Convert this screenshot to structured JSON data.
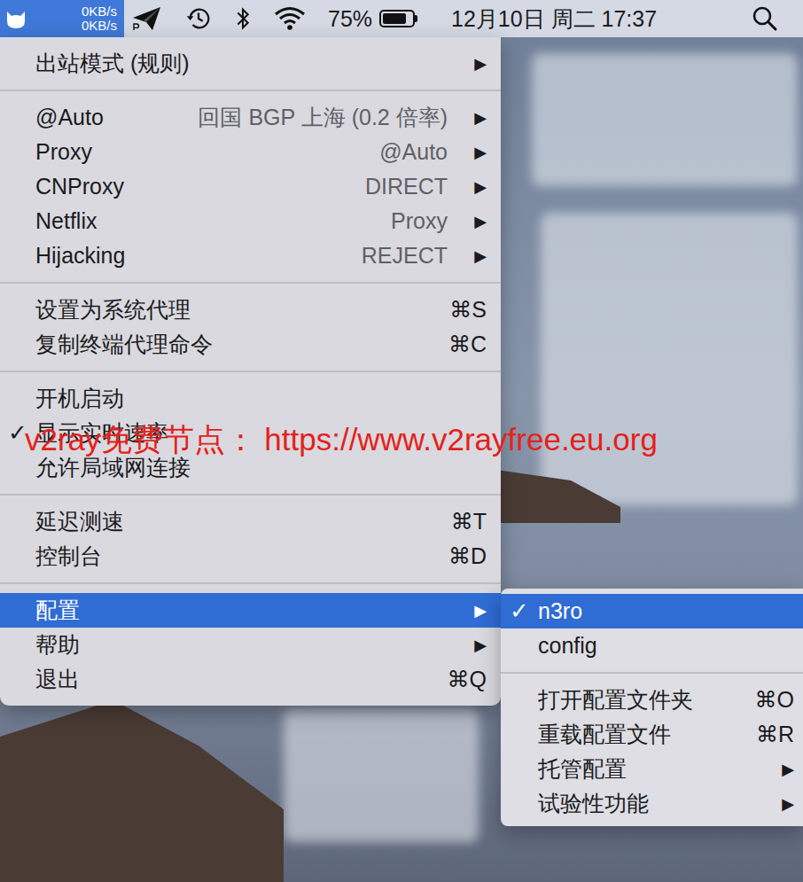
{
  "menu_bar": {
    "app_selected": true,
    "speed_up": "0KB/s",
    "speed_down": "0KB/s",
    "battery": "75%",
    "battery_level": 0.75,
    "clock": "12月10日 周二 17:37"
  },
  "check_mark": "✓",
  "menu": {
    "items": [
      {
        "kind": "submenu",
        "label": "出站模式 (规则)",
        "arrow": "▶",
        "selected": false
      },
      {
        "kind": "separator"
      },
      {
        "kind": "group",
        "label": "@Auto",
        "value": "回国 BGP 上海 (0.2 倍率)",
        "arrow": "▶",
        "selected": false
      },
      {
        "kind": "group",
        "label": "Proxy",
        "value": "@Auto",
        "arrow": "▶",
        "selected": false
      },
      {
        "kind": "group",
        "label": "CNProxy",
        "value": "DIRECT",
        "arrow": "▶",
        "selected": false
      },
      {
        "kind": "group",
        "label": "Netflix",
        "value": "Proxy",
        "arrow": "▶",
        "selected": false
      },
      {
        "kind": "group",
        "label": "Hijacking",
        "value": "REJECT",
        "arrow": "▶",
        "selected": false
      },
      {
        "kind": "separator"
      },
      {
        "kind": "command",
        "label": "设置为系统代理",
        "shortcut": "⌘S",
        "selected": false
      },
      {
        "kind": "command",
        "label": "复制终端代理命令",
        "shortcut": "⌘C",
        "selected": false
      },
      {
        "kind": "separator"
      },
      {
        "kind": "toggle",
        "label": "开机启动",
        "checked": false,
        "selected": false
      },
      {
        "kind": "toggle",
        "label": "显示实时速率",
        "checked": true,
        "selected": false
      },
      {
        "kind": "toggle",
        "label": "允许局域网连接",
        "checked": false,
        "selected": false
      },
      {
        "kind": "separator"
      },
      {
        "kind": "command",
        "label": "延迟测速",
        "shortcut": "⌘T",
        "selected": false
      },
      {
        "kind": "command",
        "label": "控制台",
        "shortcut": "⌘D",
        "selected": false
      },
      {
        "kind": "separator"
      },
      {
        "kind": "submenu",
        "label": "配置",
        "arrow": "▶",
        "selected": true
      },
      {
        "kind": "submenu",
        "label": "帮助",
        "arrow": "▶",
        "selected": false
      },
      {
        "kind": "command",
        "label": "退出",
        "shortcut": "⌘Q",
        "selected": false
      }
    ]
  },
  "submenu": {
    "items": [
      {
        "kind": "profile",
        "label": "n3ro",
        "checked": true,
        "selected": true
      },
      {
        "kind": "profile",
        "label": "config",
        "checked": false,
        "selected": false
      },
      {
        "kind": "separator"
      },
      {
        "kind": "command",
        "label": "打开配置文件夹",
        "shortcut": "⌘O",
        "selected": false
      },
      {
        "kind": "command",
        "label": "重载配置文件",
        "shortcut": "⌘R",
        "selected": false
      },
      {
        "kind": "submenu",
        "label": "托管配置",
        "arrow": "▶",
        "selected": false
      },
      {
        "kind": "submenu",
        "label": "试验性功能",
        "arrow": "▶",
        "selected": false
      }
    ]
  },
  "watermark": "v2ray免费节点： https://www.v2rayfree.eu.org"
}
